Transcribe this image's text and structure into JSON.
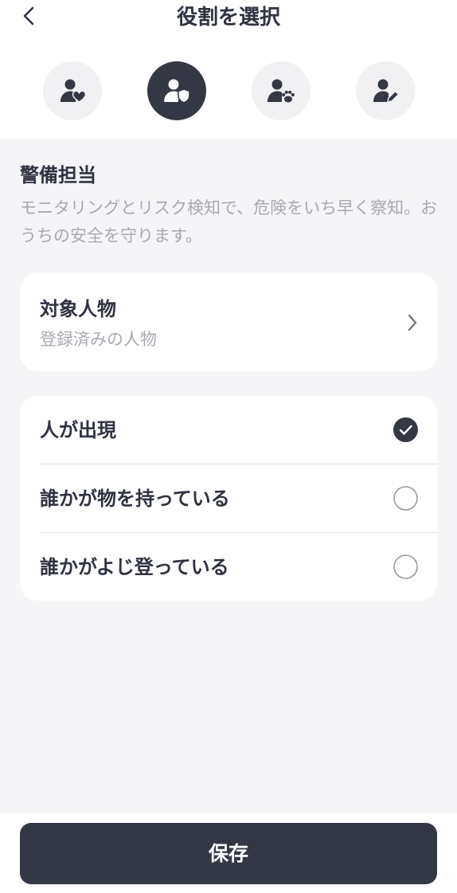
{
  "header": {
    "title": "役割を選択",
    "back_icon": "chevron-left-icon"
  },
  "roles": [
    {
      "icon": "person-heart-icon",
      "active": false
    },
    {
      "icon": "person-shield-icon",
      "active": true
    },
    {
      "icon": "person-paw-icon",
      "active": false
    },
    {
      "icon": "person-pen-icon",
      "active": false
    }
  ],
  "role": {
    "title": "警備担当",
    "description": "モニタリングとリスク検知で、危険をいち早く察知。おうちの安全を守ります。"
  },
  "target": {
    "title": "対象人物",
    "subtitle": "登録済みの人物",
    "chevron_icon": "chevron-right-icon"
  },
  "options": [
    {
      "label": "人が出現",
      "checked": true
    },
    {
      "label": "誰かが物を持っている",
      "checked": false
    },
    {
      "label": "誰かがよじ登っている",
      "checked": false
    }
  ],
  "footer": {
    "save_label": "保存"
  },
  "colors": {
    "dark": "#343744",
    "text": "#2f3240",
    "muted": "#a9aab1",
    "background": "#f5f5f7",
    "circle": "#f1f1f3"
  }
}
